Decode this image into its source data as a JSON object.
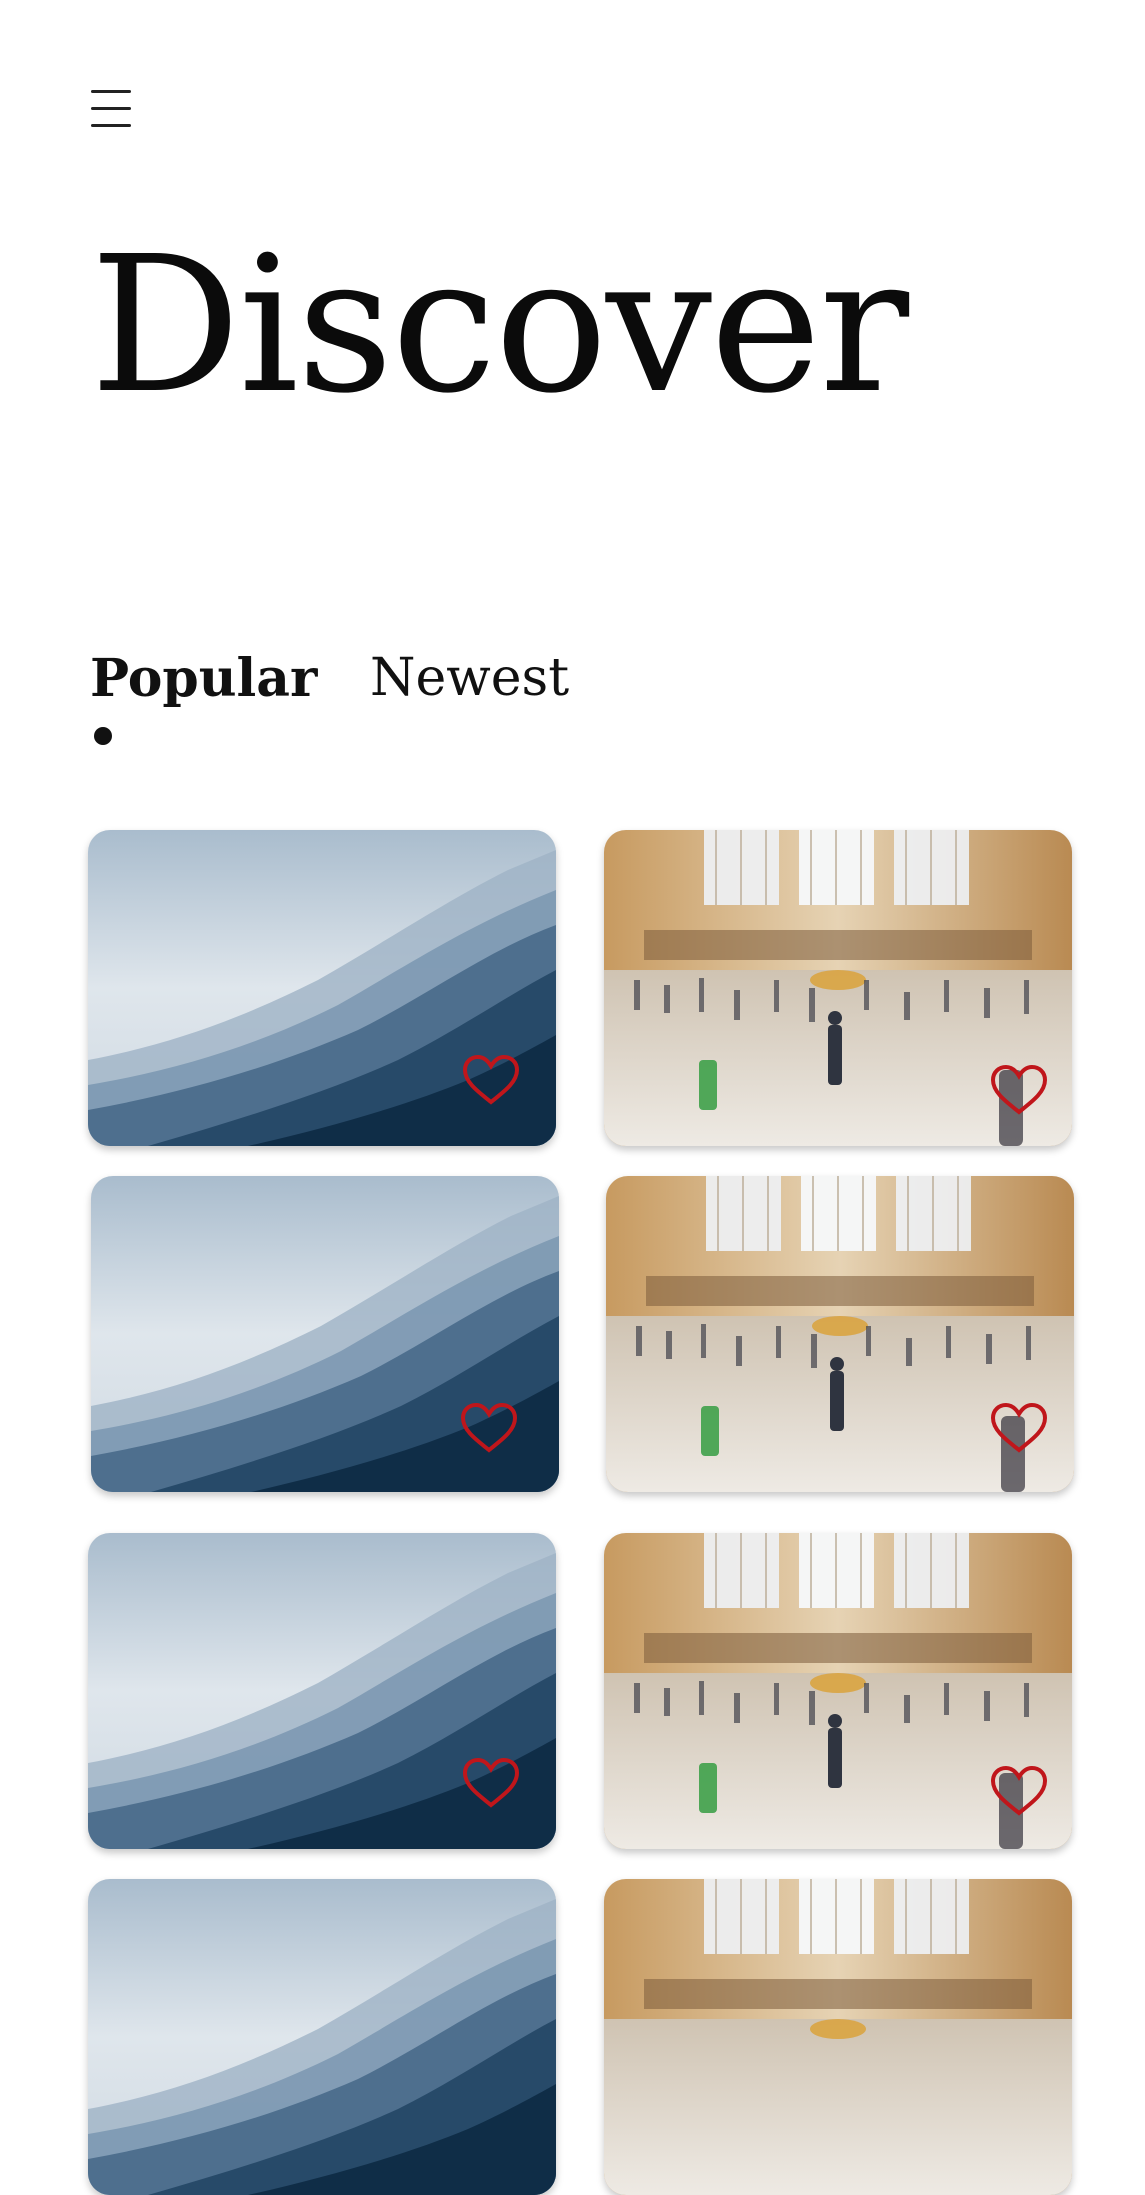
{
  "header": {
    "menu_icon": "hamburger-menu-icon",
    "title": "Discover"
  },
  "tabs": [
    {
      "label": "Popular",
      "active": true
    },
    {
      "label": "Newest",
      "active": false
    }
  ],
  "gallery": {
    "heart_icon": "heart-outline-icon",
    "heart_color": "#c0161b",
    "cards": [
      {
        "photo": "misty-mountains"
      },
      {
        "photo": "grand-central-terminal"
      },
      {
        "photo": "misty-mountains"
      },
      {
        "photo": "grand-central-terminal"
      },
      {
        "photo": "misty-mountains"
      },
      {
        "photo": "grand-central-terminal"
      },
      {
        "photo": "misty-mountains"
      },
      {
        "photo": "grand-central-terminal"
      }
    ]
  }
}
